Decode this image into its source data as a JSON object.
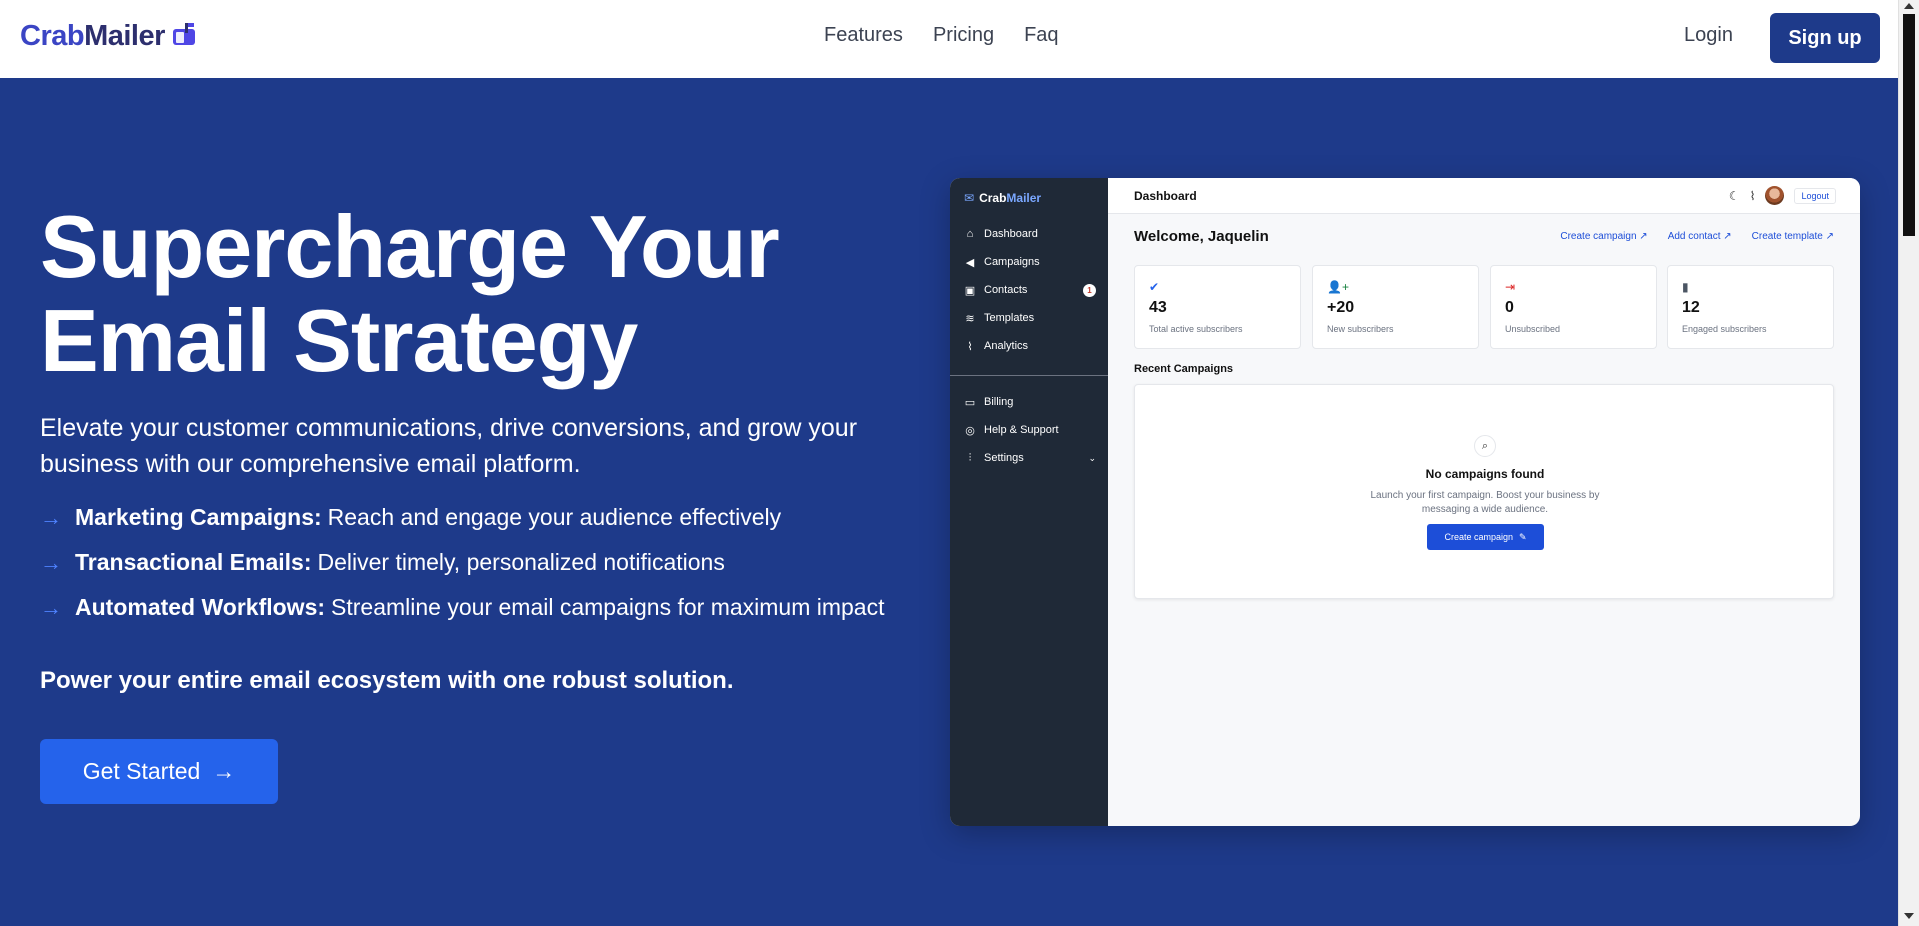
{
  "nav": {
    "brand_crab": "Crab",
    "brand_mailer": "Mailer",
    "links": [
      "Features",
      "Pricing",
      "Faq"
    ],
    "login": "Login",
    "signup": "Sign up"
  },
  "hero": {
    "title": "Supercharge Your Email Strategy",
    "subtitle": "Elevate your customer communications, drive conversions, and grow your business with our comprehensive email platform.",
    "features": [
      {
        "title": "Marketing Campaigns:",
        "desc": "Reach and engage your audience effectively"
      },
      {
        "title": "Transactional Emails:",
        "desc": "Deliver timely, personalized notifications"
      },
      {
        "title": "Automated Workflows:",
        "desc": "Streamline your email campaigns for maximum impact"
      }
    ],
    "tagline": "Power your entire email ecosystem with one robust solution.",
    "cta": "Get Started"
  },
  "mock": {
    "brand_crab": "Crab",
    "brand_mailer": "Mailer",
    "sidebar": [
      {
        "label": "Dashboard",
        "icon": "home-icon"
      },
      {
        "label": "Campaigns",
        "icon": "megaphone-icon"
      },
      {
        "label": "Contacts",
        "icon": "contacts-icon",
        "badge": "1"
      },
      {
        "label": "Templates",
        "icon": "layers-icon"
      },
      {
        "label": "Analytics",
        "icon": "chart-icon"
      },
      {
        "label": "Billing",
        "icon": "card-icon"
      },
      {
        "label": "Help & Support",
        "icon": "lifebuoy-icon"
      },
      {
        "label": "Settings",
        "icon": "sliders-icon"
      }
    ],
    "top_title": "Dashboard",
    "logout": "Logout",
    "welcome": "Welcome, Jaquelin",
    "quick_links": [
      "Create campaign",
      "Add contact",
      "Create template"
    ],
    "stats": [
      {
        "value": "43",
        "label": "Total active subscribers",
        "icon": "check-badge-icon",
        "color": "#2563eb"
      },
      {
        "value": "+20",
        "label": "New subscribers",
        "icon": "user-plus-icon",
        "color": "#15803d"
      },
      {
        "value": "0",
        "label": "Unsubscribed",
        "icon": "logout-arrow-icon",
        "color": "#dc2626"
      },
      {
        "value": "12",
        "label": "Engaged subscribers",
        "icon": "bookmark-icon",
        "color": "#4b5563"
      }
    ],
    "recent_title": "Recent Campaigns",
    "empty_title": "No campaigns found",
    "empty_desc": "Launch your first campaign. Boost your business by messaging a wide audience.",
    "empty_button": "Create campaign"
  }
}
